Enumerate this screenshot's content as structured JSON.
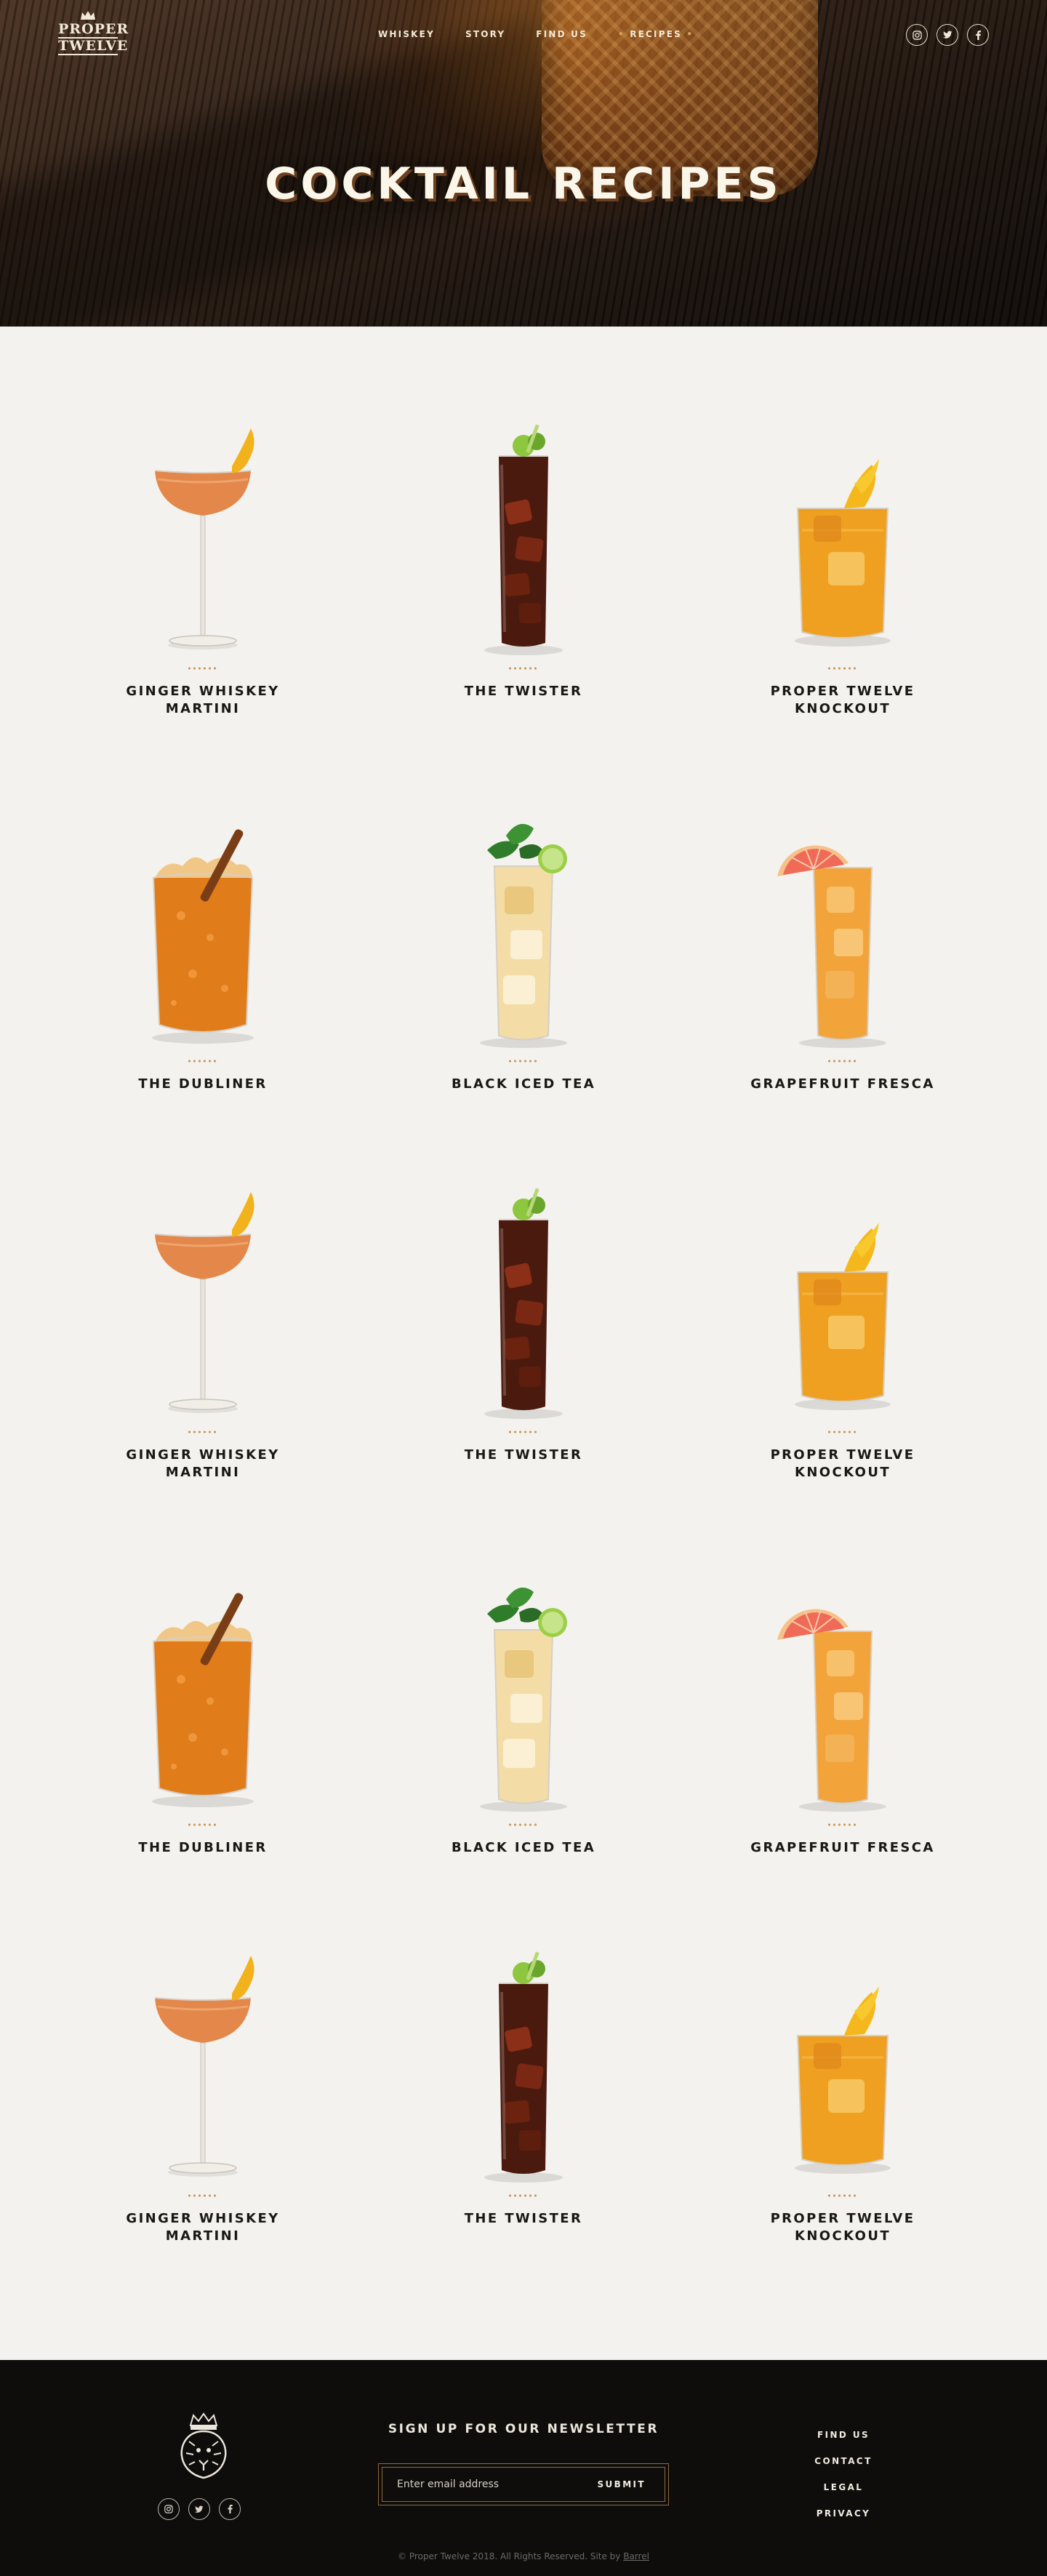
{
  "brand": {
    "logo_line_1": "PROPER",
    "logo_line_2": "TWELVE"
  },
  "nav": {
    "items": [
      {
        "label": "WHISKEY"
      },
      {
        "label": "STORY"
      },
      {
        "label": "FIND US"
      },
      {
        "label": "RECIPES",
        "active": true
      }
    ],
    "social": [
      "instagram-icon",
      "twitter-icon",
      "facebook-icon"
    ]
  },
  "hero": {
    "title": "COCKTAIL RECIPES"
  },
  "recipes": [
    {
      "name": "GINGER WHISKEY MARTINI",
      "glass": "coupe"
    },
    {
      "name": "THE TWISTER",
      "glass": "cola-tall"
    },
    {
      "name": "PROPER TWELVE KNOCKOUT",
      "glass": "rocks-orange"
    },
    {
      "name": "THE DUBLINER",
      "glass": "crushed-ice"
    },
    {
      "name": "BLACK ICED TEA",
      "glass": "mint-highball"
    },
    {
      "name": "GRAPEFRUIT FRESCA",
      "glass": "grapefruit-highball"
    },
    {
      "name": "GINGER WHISKEY MARTINI",
      "glass": "coupe"
    },
    {
      "name": "THE TWISTER",
      "glass": "cola-tall"
    },
    {
      "name": "PROPER TWELVE KNOCKOUT",
      "glass": "rocks-orange"
    },
    {
      "name": "THE DUBLINER",
      "glass": "crushed-ice"
    },
    {
      "name": "BLACK ICED TEA",
      "glass": "mint-highball"
    },
    {
      "name": "GRAPEFRUIT FRESCA",
      "glass": "grapefruit-highball"
    },
    {
      "name": "GINGER WHISKEY MARTINI",
      "glass": "coupe"
    },
    {
      "name": "THE TWISTER",
      "glass": "cola-tall"
    },
    {
      "name": "PROPER TWELVE KNOCKOUT",
      "glass": "rocks-orange"
    }
  ],
  "footer": {
    "newsletter_title": "SIGN UP FOR OUR NEWSLETTER",
    "email_placeholder": "Enter email address",
    "submit_label": "SUBMIT",
    "links": [
      "FIND US",
      "CONTACT",
      "LEGAL",
      "PRIVACY"
    ],
    "copyright": "© Proper Twelve 2018. All Rights Reserved. Site by",
    "credit": "Barrel"
  },
  "colors": {
    "page_background": "#f4f2ee",
    "footer_background": "#0e0d0c",
    "accent_dots": "#c79355",
    "hero_title": "#fbf6ea"
  }
}
